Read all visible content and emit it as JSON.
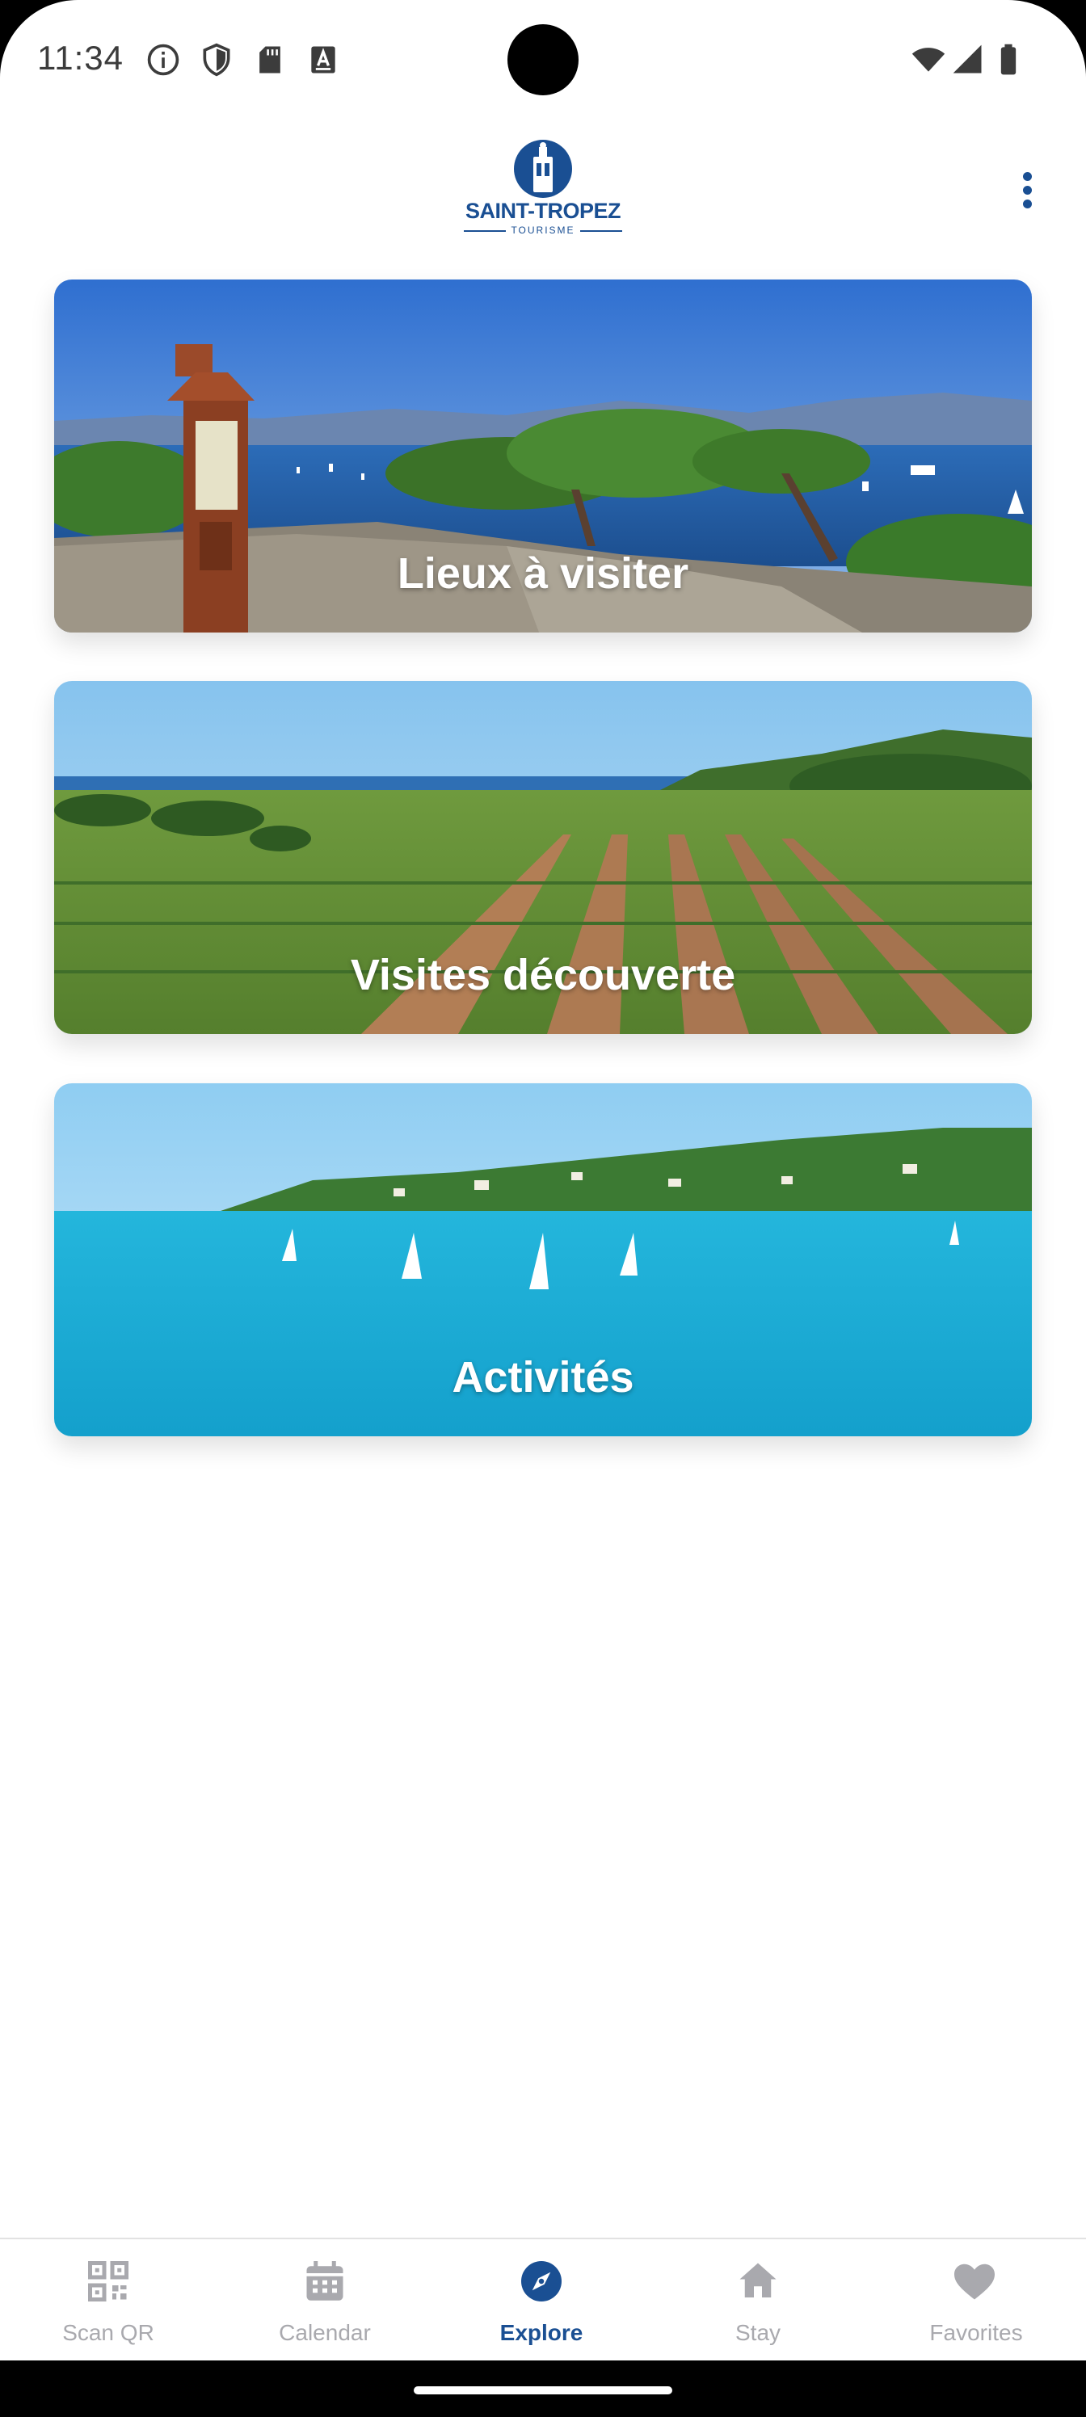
{
  "status_bar": {
    "time": "11:34",
    "left_icons": [
      "info-icon",
      "shield-icon",
      "sd-card-icon",
      "keyboard-a-icon"
    ],
    "right_icons": [
      "wifi-icon",
      "signal-icon",
      "battery-icon"
    ]
  },
  "header": {
    "logo_text": "SAINT-TROPEZ",
    "logo_subtext": "TOURISME",
    "menu_icon": "more-vert-icon"
  },
  "cards": [
    {
      "label": "Lieux à visiter"
    },
    {
      "label": "Visites découverte"
    },
    {
      "label": "Activités"
    }
  ],
  "bottom_nav": {
    "items": [
      {
        "label": "Scan QR",
        "icon": "qr-code-icon"
      },
      {
        "label": "Calendar",
        "icon": "calendar-icon"
      },
      {
        "label": "Explore",
        "icon": "compass-icon"
      },
      {
        "label": "Stay",
        "icon": "home-icon"
      },
      {
        "label": "Favorites",
        "icon": "heart-icon"
      }
    ],
    "active_item": "Explore"
  },
  "colors": {
    "brand": "#1a4f93",
    "inactive": "#a9a9ae"
  }
}
